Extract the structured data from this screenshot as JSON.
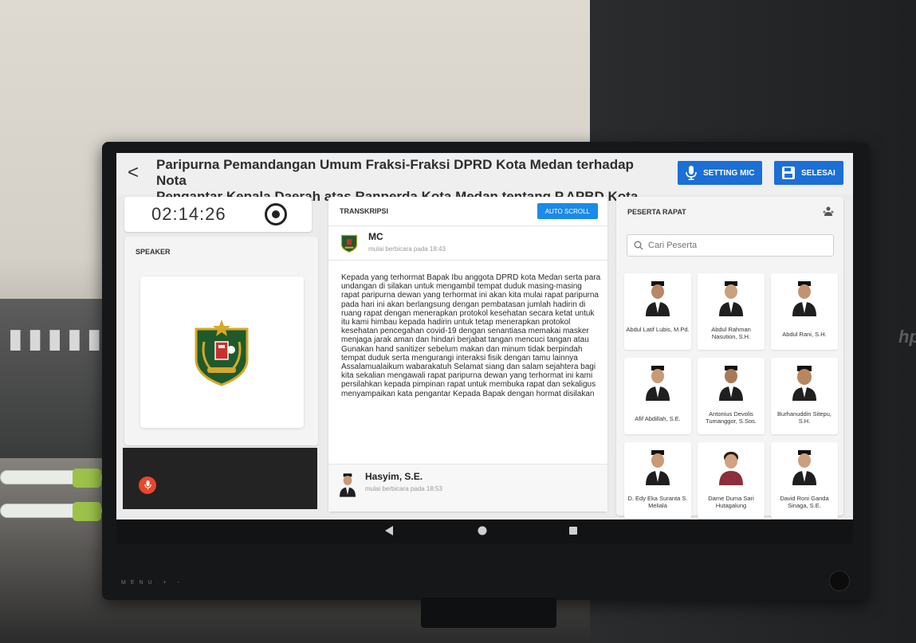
{
  "header": {
    "title_line1": "Paripurna Pemandangan Umum Fraksi-Fraksi DPRD Kota Medan terhadap Nota",
    "title_line2": "Pengantar Kepala Daerah atas Ranperda Kota Medan tentang P.APBD Kota Medan",
    "setting_mic_label": "SETTING MIC",
    "selesai_label": "SELESAI",
    "back_glyph": "<"
  },
  "timer": {
    "value": "02:14:26"
  },
  "speaker": {
    "header": "SPEAKER"
  },
  "transcript": {
    "header": "TRANSKRIPSI",
    "auto_scroll_label": "AUTO SCROLL",
    "entries": [
      {
        "name": "MC",
        "time": "mulai berbicara pada 18:43",
        "text": "Kepada yang terhormat Bapak Ibu anggota DPRD kota Medan serta para undangan di silakan untuk mengambil tempat duduk masing-masing rapat paripurna dewan yang terhormat ini akan kita mulai rapat paripurna pada hari ini akan berlangsung dengan pembatasan jumlah hadirin di ruang rapat dengan menerapkan protokol kesehatan secara ketat untuk itu kami himbau kepada hadirin untuk tetap menerapkan protokol kesehatan pencegahan covid-19 dengan senantiasa memakai masker menjaga jarak aman dan hindari berjabat tangan mencuci tangan atau Gunakan hand sanitizer sebelum makan dan minum tidak berpindah tempat duduk serta mengurangi interaksi fisik dengan tamu lainnya  Assalamualaikum wabarakatuh Selamat siang dan salam sejahtera bagi kita sekalian mengawali rapat paripurna dewan yang terhormat ini kami persilahkan kepada pimpinan rapat untuk membuka rapat dan sekaligus menyampaikan kata pengantar Kepada Bapak dengan hormat disilakan"
      },
      {
        "name": "Hasyim, S.E.",
        "time": "mulai berbicara pada 18:53"
      }
    ]
  },
  "participants": {
    "header": "PESERTA RAPAT",
    "search_placeholder": "Cari Peserta",
    "members": [
      {
        "name": "Abdul Latif Lubis, M.Pd."
      },
      {
        "name": "Abdul Rahman Nasution, S.H."
      },
      {
        "name": "Abdul Rani, S.H."
      },
      {
        "name": "Afif Abdillah, S.E."
      },
      {
        "name": "Antonius Devolis Tumanggor, S.Sos."
      },
      {
        "name": "Burhanuddin Sitepu, S.H."
      },
      {
        "name": "D. Edy Eka Suranta S. Meliala"
      },
      {
        "name": "Dame Duma Sari Hutagalung"
      },
      {
        "name": "David Roni Ganda Sinaga, S.E."
      }
    ]
  },
  "device": {
    "menu_label": "MENU  +  -",
    "brand": "hp"
  },
  "colors": {
    "primary_button": "#1b6fd6",
    "auto_scroll": "#1b8ae8",
    "mic_active": "#e8462e",
    "emblem_green": "#1f5a2c",
    "emblem_gold": "#d6a82a"
  }
}
